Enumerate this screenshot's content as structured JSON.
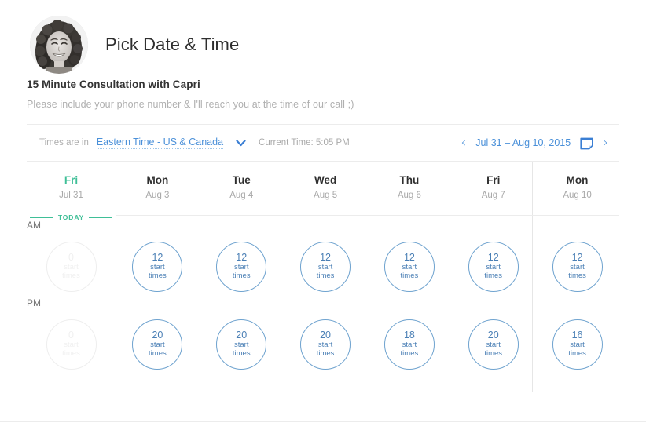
{
  "header": {
    "title": "Pick Date & Time",
    "avatar_alt": "avatar"
  },
  "event": {
    "title": "15 Minute Consultation with Capri",
    "description": "Please include your phone number & I'll reach you at the time of our call ;)"
  },
  "toolbar": {
    "timezone_label": "Times are in",
    "timezone_value": "Eastern Time - US & Canada",
    "current_time": "Current Time: 5:05 PM",
    "date_range": "Jul 31 – Aug 10, 2015",
    "prev_arrow": "‹",
    "next_arrow": "›",
    "today_label": "TODAY"
  },
  "grid": {
    "am_label": "AM",
    "pm_label": "PM",
    "start_times_label_line1": "start",
    "start_times_label_line2": "times",
    "days": [
      {
        "dow": "Fri",
        "dom": "Jul 31",
        "is_today": true,
        "am": "0",
        "pm": "0"
      },
      {
        "dow": "Mon",
        "dom": "Aug 3",
        "is_today": false,
        "am": "12",
        "pm": "20"
      },
      {
        "dow": "Tue",
        "dom": "Aug 4",
        "is_today": false,
        "am": "12",
        "pm": "20"
      },
      {
        "dow": "Wed",
        "dom": "Aug 5",
        "is_today": false,
        "am": "12",
        "pm": "20"
      },
      {
        "dow": "Thu",
        "dom": "Aug 6",
        "is_today": false,
        "am": "12",
        "pm": "18"
      },
      {
        "dow": "Fri",
        "dom": "Aug 7",
        "is_today": false,
        "am": "12",
        "pm": "20"
      },
      {
        "dow": "Mon",
        "dom": "Aug 10",
        "is_today": false,
        "am": "12",
        "pm": "16"
      }
    ]
  },
  "colors": {
    "link_blue": "#4a90d9",
    "circle_blue": "#6fa3cf",
    "today_green": "#3fbf97",
    "muted_gray": "#b0b0b0"
  }
}
